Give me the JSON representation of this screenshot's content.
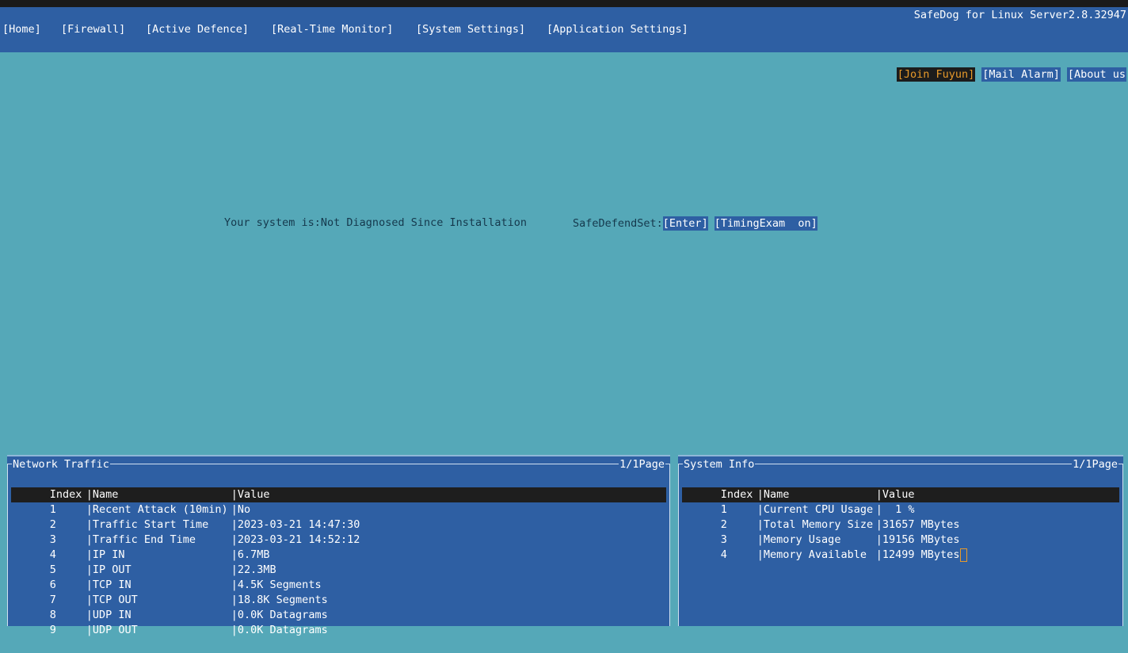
{
  "app": {
    "title": "SafeDog for Linux Server2.8.32947"
  },
  "menu": {
    "items": [
      {
        "label": "[Home]"
      },
      {
        "label": "[Firewall]"
      },
      {
        "label": "[Active Defence]"
      },
      {
        "label": "[Real-Time Monitor]"
      },
      {
        "label": "[System Settings]"
      },
      {
        "label": "[Application Settings]"
      }
    ]
  },
  "links": {
    "join_fuyun": "[Join Fuyun]",
    "mail_alarm": "[Mail Alarm]",
    "about_us": "[About us"
  },
  "status": {
    "text": "Your system is:Not Diagnosed Since Installation",
    "safe_defend_label": "SafeDefendSet:",
    "enter_button": "[Enter]",
    "timing_exam_button": "[TimingExam  on]"
  },
  "network_traffic": {
    "title": "Network Traffic",
    "page": "1/1Page",
    "headers": {
      "index": "Index",
      "name": "|Name",
      "value": "|Value"
    },
    "rows": [
      {
        "index": "1",
        "name": "|Recent Attack (10min)",
        "value": "|No"
      },
      {
        "index": "2",
        "name": "|Traffic Start Time",
        "value": "|2023-03-21 14:47:30"
      },
      {
        "index": "3",
        "name": "|Traffic End Time",
        "value": "|2023-03-21 14:52:12"
      },
      {
        "index": "4",
        "name": "|IP IN",
        "value": "|6.7MB"
      },
      {
        "index": "5",
        "name": "|IP OUT",
        "value": "|22.3MB"
      },
      {
        "index": "6",
        "name": "|TCP IN",
        "value": "|4.5K Segments"
      },
      {
        "index": "7",
        "name": "|TCP OUT",
        "value": "|18.8K Segments"
      },
      {
        "index": "8",
        "name": "|UDP IN",
        "value": "|0.0K Datagrams"
      },
      {
        "index": "9",
        "name": "|UDP OUT",
        "value": "|0.0K Datagrams"
      }
    ]
  },
  "system_info": {
    "title": "System Info",
    "page": "1/1Page",
    "headers": {
      "index": "Index",
      "name": "|Name",
      "value": "|Value"
    },
    "rows": [
      {
        "index": "1",
        "name": "|Current CPU Usage",
        "value": "|  1 %"
      },
      {
        "index": "2",
        "name": "|Total Memory Size",
        "value": "|31657 MBytes"
      },
      {
        "index": "3",
        "name": "|Memory Usage",
        "value": "|19156 MBytes"
      },
      {
        "index": "4",
        "name": "|Memory Available",
        "value": "|12499 MBytes"
      }
    ]
  },
  "colors": {
    "background": "#55a8b8",
    "panel": "#2e5fa3",
    "selected_row": "#1e1e1e",
    "highlight": "#e89a2a"
  }
}
